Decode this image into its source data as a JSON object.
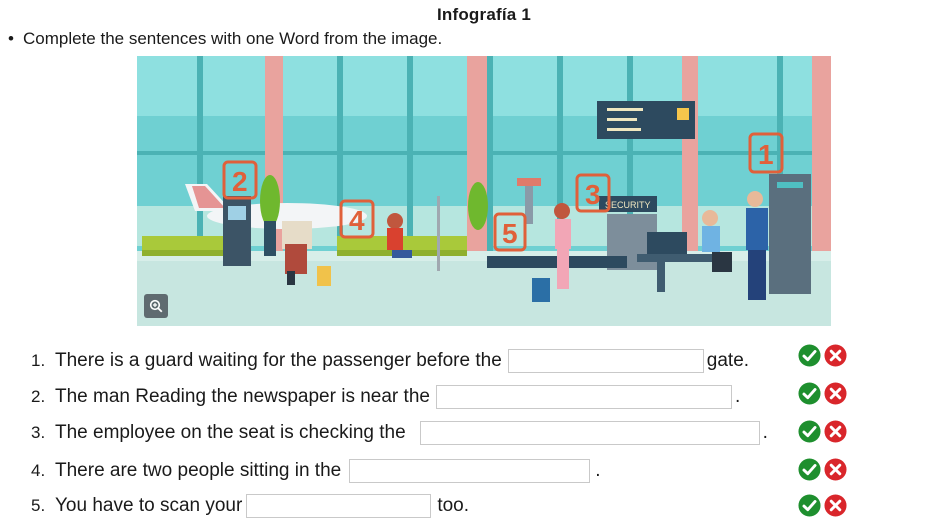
{
  "title": "Infografía 1",
  "instruction": {
    "bullet": "•",
    "text": "Complete the sentences with one Word from the image."
  },
  "image": {
    "labels": [
      "1",
      "2",
      "3",
      "4",
      "5"
    ],
    "sign_text": "SECURITY",
    "accent_color": "#e0603a"
  },
  "questions": [
    {
      "number": "1.",
      "before": "There is a guard waiting for the passenger before the",
      "after": "gate."
    },
    {
      "number": "2.",
      "before": "The man Reading the newspaper is near the",
      "after": "."
    },
    {
      "number": "3.",
      "before": "The employee on the seat is checking the",
      "after": "."
    },
    {
      "number": "4.",
      "before": "There are two people sitting in the",
      "after": "."
    },
    {
      "number": "5.",
      "before": "You have to scan your",
      "after": "too."
    }
  ],
  "colors": {
    "check": "#1e8f2e",
    "cross": "#d9262b"
  }
}
